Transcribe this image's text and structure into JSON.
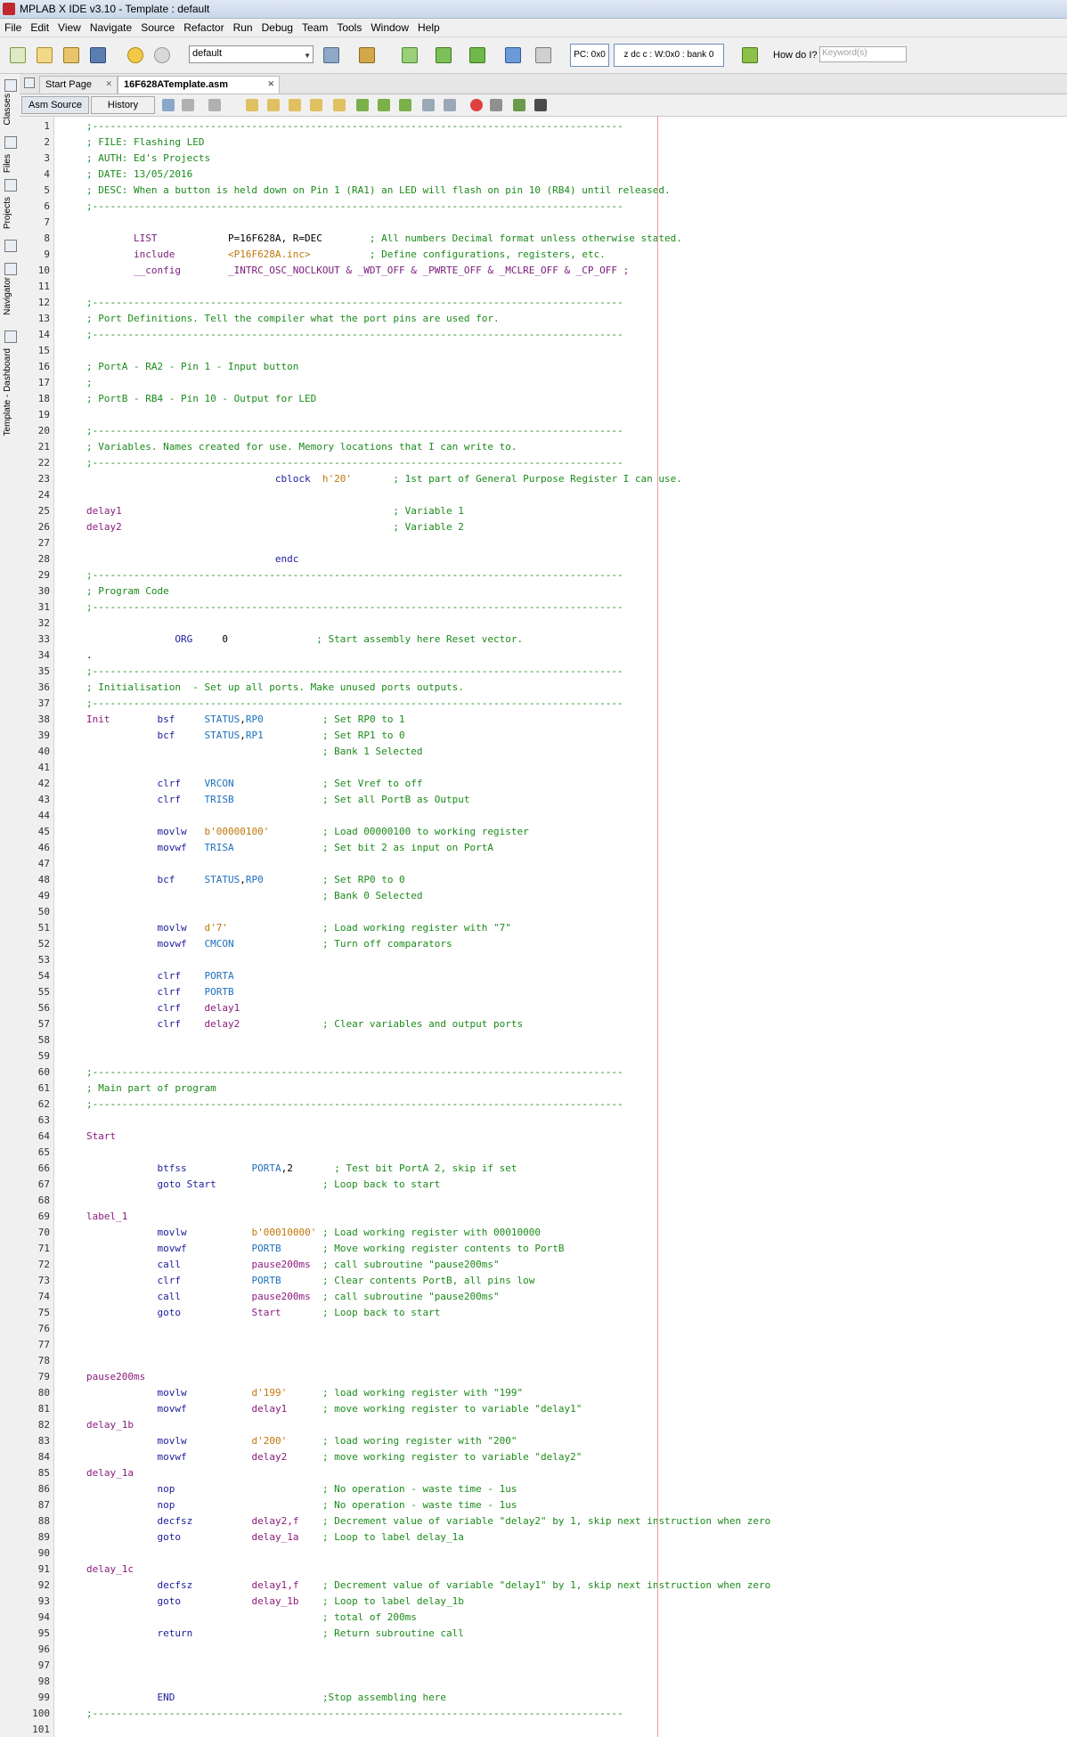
{
  "window": {
    "title": "MPLAB X IDE v3.10 - Template : default"
  },
  "menu": [
    "File",
    "Edit",
    "View",
    "Navigate",
    "Source",
    "Refactor",
    "Run",
    "Debug",
    "Team",
    "Tools",
    "Window",
    "Help"
  ],
  "toolbar": {
    "config": "default",
    "pc": "PC: 0x0",
    "registers": "z dc c  : W:0x0 : bank 0",
    "howdo": "How do I?",
    "search_placeholder": "Keyword(s)"
  },
  "side_tabs": [
    "Classes",
    "Files",
    "Projects",
    "Navigator",
    "Template - Dashboard"
  ],
  "tabs": [
    {
      "label": "Start Page"
    },
    {
      "label": "16F628ATemplate.asm"
    }
  ],
  "editor_tabs": [
    {
      "label": "Asm Source"
    },
    {
      "label": "History"
    }
  ],
  "code": [
    [
      [
        "c",
        ";------------------------------------------------------------------------------------------"
      ]
    ],
    [
      [
        "c",
        "; FILE: Flashing LED"
      ]
    ],
    [
      [
        "c",
        "; AUTH: Ed's Projects"
      ]
    ],
    [
      [
        "c",
        "; DATE: 13/05/2016"
      ]
    ],
    [
      [
        "c",
        "; DESC: When a button is held down on Pin 1 (RA1) an LED will flash on pin 10 (RB4) until released."
      ]
    ],
    [
      [
        "c",
        ";------------------------------------------------------------------------------------------"
      ]
    ],
    [],
    [
      [
        "t",
        "        "
      ],
      [
        "i",
        "LIST"
      ],
      [
        "t",
        "            P=16F628A, R=DEC        "
      ],
      [
        "c",
        "; All numbers Decimal format unless otherwise stated."
      ]
    ],
    [
      [
        "t",
        "        "
      ],
      [
        "i",
        "include"
      ],
      [
        "t",
        "         "
      ],
      [
        "s",
        "<P16F628A.inc>"
      ],
      [
        "t",
        "          "
      ],
      [
        "c",
        "; Define configurations, registers, etc."
      ]
    ],
    [
      [
        "t",
        "        "
      ],
      [
        "i",
        "__config"
      ],
      [
        "t",
        "        "
      ],
      [
        "i",
        "_INTRC_OSC_NOCLKOUT & _WDT_OFF & _PWRTE_OFF & _MCLRE_OFF & _CP_OFF ;"
      ]
    ],
    [],
    [
      [
        "c",
        ";------------------------------------------------------------------------------------------"
      ]
    ],
    [
      [
        "c",
        "; Port Definitions. Tell the compiler what the port pins are used for."
      ]
    ],
    [
      [
        "c",
        ";------------------------------------------------------------------------------------------"
      ]
    ],
    [],
    [
      [
        "c",
        "; PortA - RA2 - Pin 1 - Input button"
      ]
    ],
    [
      [
        "c",
        ";"
      ]
    ],
    [
      [
        "c",
        "; PortB - RB4 - Pin 10 - Output for LED"
      ]
    ],
    [],
    [
      [
        "c",
        ";------------------------------------------------------------------------------------------"
      ]
    ],
    [
      [
        "c",
        "; Variables. Names created for use. Memory locations that I can write to."
      ]
    ],
    [
      [
        "c",
        ";------------------------------------------------------------------------------------------"
      ]
    ],
    [
      [
        "t",
        "                                "
      ],
      [
        "k",
        "cblock"
      ],
      [
        "t",
        "  "
      ],
      [
        "s",
        "h'20'"
      ],
      [
        "t",
        "       "
      ],
      [
        "c",
        "; 1st part of General Purpose Register I can use."
      ]
    ],
    [],
    [
      [
        "l",
        "delay1"
      ],
      [
        "t",
        "                                              "
      ],
      [
        "c",
        "; Variable 1"
      ]
    ],
    [
      [
        "l",
        "delay2"
      ],
      [
        "t",
        "                                              "
      ],
      [
        "c",
        "; Variable 2"
      ]
    ],
    [],
    [
      [
        "t",
        "                                "
      ],
      [
        "k",
        "endc"
      ]
    ],
    [
      [
        "c",
        ";------------------------------------------------------------------------------------------"
      ]
    ],
    [
      [
        "c",
        "; Program Code"
      ]
    ],
    [
      [
        "c",
        ";------------------------------------------------------------------------------------------"
      ]
    ],
    [],
    [
      [
        "t",
        "               "
      ],
      [
        "k",
        "ORG"
      ],
      [
        "t",
        "     0               "
      ],
      [
        "c",
        "; Start assembly here Reset vector."
      ]
    ],
    [
      [
        "t",
        "."
      ]
    ],
    [
      [
        "c",
        ";------------------------------------------------------------------------------------------"
      ]
    ],
    [
      [
        "c",
        "; Initialisation  - Set up all ports. Make unused ports outputs."
      ]
    ],
    [
      [
        "c",
        ";------------------------------------------------------------------------------------------"
      ]
    ],
    [
      [
        "l",
        "Init"
      ],
      [
        "t",
        "        "
      ],
      [
        "k",
        "bsf"
      ],
      [
        "t",
        "     "
      ],
      [
        "o",
        "STATUS"
      ],
      [
        "t",
        ","
      ],
      [
        "o",
        "RP0"
      ],
      [
        "t",
        "          "
      ],
      [
        "c",
        "; Set RP0 to 1"
      ]
    ],
    [
      [
        "t",
        "            "
      ],
      [
        "k",
        "bcf"
      ],
      [
        "t",
        "     "
      ],
      [
        "o",
        "STATUS"
      ],
      [
        "t",
        ","
      ],
      [
        "o",
        "RP1"
      ],
      [
        "t",
        "          "
      ],
      [
        "c",
        "; Set RP1 to 0"
      ]
    ],
    [
      [
        "t",
        "                                        "
      ],
      [
        "c",
        "; Bank 1 Selected"
      ]
    ],
    [],
    [
      [
        "t",
        "            "
      ],
      [
        "k",
        "clrf"
      ],
      [
        "t",
        "    "
      ],
      [
        "o",
        "VRCON"
      ],
      [
        "t",
        "               "
      ],
      [
        "c",
        "; Set Vref to off"
      ]
    ],
    [
      [
        "t",
        "            "
      ],
      [
        "k",
        "clrf"
      ],
      [
        "t",
        "    "
      ],
      [
        "o",
        "TRISB"
      ],
      [
        "t",
        "               "
      ],
      [
        "c",
        "; Set all PortB as Output"
      ]
    ],
    [],
    [
      [
        "t",
        "            "
      ],
      [
        "k",
        "movlw"
      ],
      [
        "t",
        "   "
      ],
      [
        "s",
        "b'00000100'"
      ],
      [
        "t",
        "         "
      ],
      [
        "c",
        "; Load 00000100 to working register"
      ]
    ],
    [
      [
        "t",
        "            "
      ],
      [
        "k",
        "movwf"
      ],
      [
        "t",
        "   "
      ],
      [
        "o",
        "TRISA"
      ],
      [
        "t",
        "               "
      ],
      [
        "c",
        "; Set bit 2 as input on PortA"
      ]
    ],
    [],
    [
      [
        "t",
        "            "
      ],
      [
        "k",
        "bcf"
      ],
      [
        "t",
        "     "
      ],
      [
        "o",
        "STATUS"
      ],
      [
        "t",
        ","
      ],
      [
        "o",
        "RP0"
      ],
      [
        "t",
        "          "
      ],
      [
        "c",
        "; Set RP0 to 0"
      ]
    ],
    [
      [
        "t",
        "                                        "
      ],
      [
        "c",
        "; Bank 0 Selected"
      ]
    ],
    [],
    [
      [
        "t",
        "            "
      ],
      [
        "k",
        "movlw"
      ],
      [
        "t",
        "   "
      ],
      [
        "s",
        "d'7'"
      ],
      [
        "t",
        "                "
      ],
      [
        "c",
        "; Load working register with \"7\""
      ]
    ],
    [
      [
        "t",
        "            "
      ],
      [
        "k",
        "movwf"
      ],
      [
        "t",
        "   "
      ],
      [
        "o",
        "CMCON"
      ],
      [
        "t",
        "               "
      ],
      [
        "c",
        "; Turn off comparators"
      ]
    ],
    [],
    [
      [
        "t",
        "            "
      ],
      [
        "k",
        "clrf"
      ],
      [
        "t",
        "    "
      ],
      [
        "o",
        "PORTA"
      ]
    ],
    [
      [
        "t",
        "            "
      ],
      [
        "k",
        "clrf"
      ],
      [
        "t",
        "    "
      ],
      [
        "o",
        "PORTB"
      ]
    ],
    [
      [
        "t",
        "            "
      ],
      [
        "k",
        "clrf"
      ],
      [
        "t",
        "    "
      ],
      [
        "l",
        "delay1"
      ]
    ],
    [
      [
        "t",
        "            "
      ],
      [
        "k",
        "clrf"
      ],
      [
        "t",
        "    "
      ],
      [
        "l",
        "delay2"
      ],
      [
        "t",
        "              "
      ],
      [
        "c",
        "; Clear variables and output ports"
      ]
    ],
    [],
    [],
    [
      [
        "c",
        ";------------------------------------------------------------------------------------------"
      ]
    ],
    [
      [
        "c",
        "; Main part of program"
      ]
    ],
    [
      [
        "c",
        ";------------------------------------------------------------------------------------------"
      ]
    ],
    [],
    [
      [
        "l",
        "Start"
      ]
    ],
    [],
    [
      [
        "t",
        "            "
      ],
      [
        "k",
        "btfss"
      ],
      [
        "t",
        "           "
      ],
      [
        "o",
        "PORTA"
      ],
      [
        "t",
        ",2       "
      ],
      [
        "c",
        "; Test bit PortA 2, skip if set"
      ]
    ],
    [
      [
        "t",
        "            "
      ],
      [
        "k",
        "goto Start"
      ],
      [
        "t",
        "                  "
      ],
      [
        "c",
        "; Loop back to start"
      ]
    ],
    [],
    [
      [
        "l",
        "label_1"
      ]
    ],
    [
      [
        "t",
        "            "
      ],
      [
        "k",
        "movlw"
      ],
      [
        "t",
        "           "
      ],
      [
        "s",
        "b'00010000'"
      ],
      [
        "t",
        " "
      ],
      [
        "c",
        "; Load working register with 00010000"
      ]
    ],
    [
      [
        "t",
        "            "
      ],
      [
        "k",
        "movwf"
      ],
      [
        "t",
        "           "
      ],
      [
        "o",
        "PORTB"
      ],
      [
        "t",
        "       "
      ],
      [
        "c",
        "; Move working register contents to PortB"
      ]
    ],
    [
      [
        "t",
        "            "
      ],
      [
        "k",
        "call"
      ],
      [
        "t",
        "            "
      ],
      [
        "l",
        "pause200ms"
      ],
      [
        "t",
        "  "
      ],
      [
        "c",
        "; call subroutine \"pause200ms\""
      ]
    ],
    [
      [
        "t",
        "            "
      ],
      [
        "k",
        "clrf"
      ],
      [
        "t",
        "            "
      ],
      [
        "o",
        "PORTB"
      ],
      [
        "t",
        "       "
      ],
      [
        "c",
        "; Clear contents PortB, all pins low"
      ]
    ],
    [
      [
        "t",
        "            "
      ],
      [
        "k",
        "call"
      ],
      [
        "t",
        "            "
      ],
      [
        "l",
        "pause200ms"
      ],
      [
        "t",
        "  "
      ],
      [
        "c",
        "; call subroutine \"pause200ms\""
      ]
    ],
    [
      [
        "t",
        "            "
      ],
      [
        "k",
        "goto"
      ],
      [
        "t",
        "            "
      ],
      [
        "l",
        "Start"
      ],
      [
        "t",
        "       "
      ],
      [
        "c",
        "; Loop back to start"
      ]
    ],
    [],
    [],
    [],
    [
      [
        "l",
        "pause200ms"
      ]
    ],
    [
      [
        "t",
        "            "
      ],
      [
        "k",
        "movlw"
      ],
      [
        "t",
        "           "
      ],
      [
        "s",
        "d'199'"
      ],
      [
        "t",
        "      "
      ],
      [
        "c",
        "; load working register with \"199\""
      ]
    ],
    [
      [
        "t",
        "            "
      ],
      [
        "k",
        "movwf"
      ],
      [
        "t",
        "           "
      ],
      [
        "l",
        "delay1"
      ],
      [
        "t",
        "      "
      ],
      [
        "c",
        "; move working register to variable \"delay1\""
      ]
    ],
    [
      [
        "l",
        "delay_1b"
      ]
    ],
    [
      [
        "t",
        "            "
      ],
      [
        "k",
        "movlw"
      ],
      [
        "t",
        "           "
      ],
      [
        "s",
        "d'200'"
      ],
      [
        "t",
        "      "
      ],
      [
        "c",
        "; load woring register with \"200\""
      ]
    ],
    [
      [
        "t",
        "            "
      ],
      [
        "k",
        "movwf"
      ],
      [
        "t",
        "           "
      ],
      [
        "l",
        "delay2"
      ],
      [
        "t",
        "      "
      ],
      [
        "c",
        "; move working register to variable \"delay2\""
      ]
    ],
    [
      [
        "l",
        "delay_1a"
      ]
    ],
    [
      [
        "t",
        "            "
      ],
      [
        "k",
        "nop"
      ],
      [
        "t",
        "                         "
      ],
      [
        "c",
        "; No operation - waste time - 1us"
      ]
    ],
    [
      [
        "t",
        "            "
      ],
      [
        "k",
        "nop"
      ],
      [
        "t",
        "                         "
      ],
      [
        "c",
        "; No operation - waste time - 1us"
      ]
    ],
    [
      [
        "t",
        "            "
      ],
      [
        "k",
        "decfsz"
      ],
      [
        "t",
        "          "
      ],
      [
        "l",
        "delay2,f"
      ],
      [
        "t",
        "    "
      ],
      [
        "c",
        "; Decrement value of variable \"delay2\" by 1, skip next instruction when zero"
      ]
    ],
    [
      [
        "t",
        "            "
      ],
      [
        "k",
        "goto"
      ],
      [
        "t",
        "            "
      ],
      [
        "l",
        "delay_1a"
      ],
      [
        "t",
        "    "
      ],
      [
        "c",
        "; Loop to label delay_1a"
      ]
    ],
    [],
    [
      [
        "l",
        "delay_1c"
      ]
    ],
    [
      [
        "t",
        "            "
      ],
      [
        "k",
        "decfsz"
      ],
      [
        "t",
        "          "
      ],
      [
        "l",
        "delay1,f"
      ],
      [
        "t",
        "    "
      ],
      [
        "c",
        "; Decrement value of variable \"delay1\" by 1, skip next instruction when zero"
      ]
    ],
    [
      [
        "t",
        "            "
      ],
      [
        "k",
        "goto"
      ],
      [
        "t",
        "            "
      ],
      [
        "l",
        "delay_1b"
      ],
      [
        "t",
        "    "
      ],
      [
        "c",
        "; Loop to label delay_1b"
      ]
    ],
    [
      [
        "t",
        "                                        "
      ],
      [
        "c",
        "; total of 200ms"
      ]
    ],
    [
      [
        "t",
        "            "
      ],
      [
        "k",
        "return"
      ],
      [
        "t",
        "                      "
      ],
      [
        "c",
        "; Return subroutine call"
      ]
    ],
    [],
    [],
    [],
    [
      [
        "t",
        "            "
      ],
      [
        "k",
        "END"
      ],
      [
        "t",
        "                         "
      ],
      [
        "c",
        ";Stop assembling here"
      ]
    ],
    [
      [
        "c",
        ";------------------------------------------------------------------------------------------"
      ]
    ],
    []
  ]
}
